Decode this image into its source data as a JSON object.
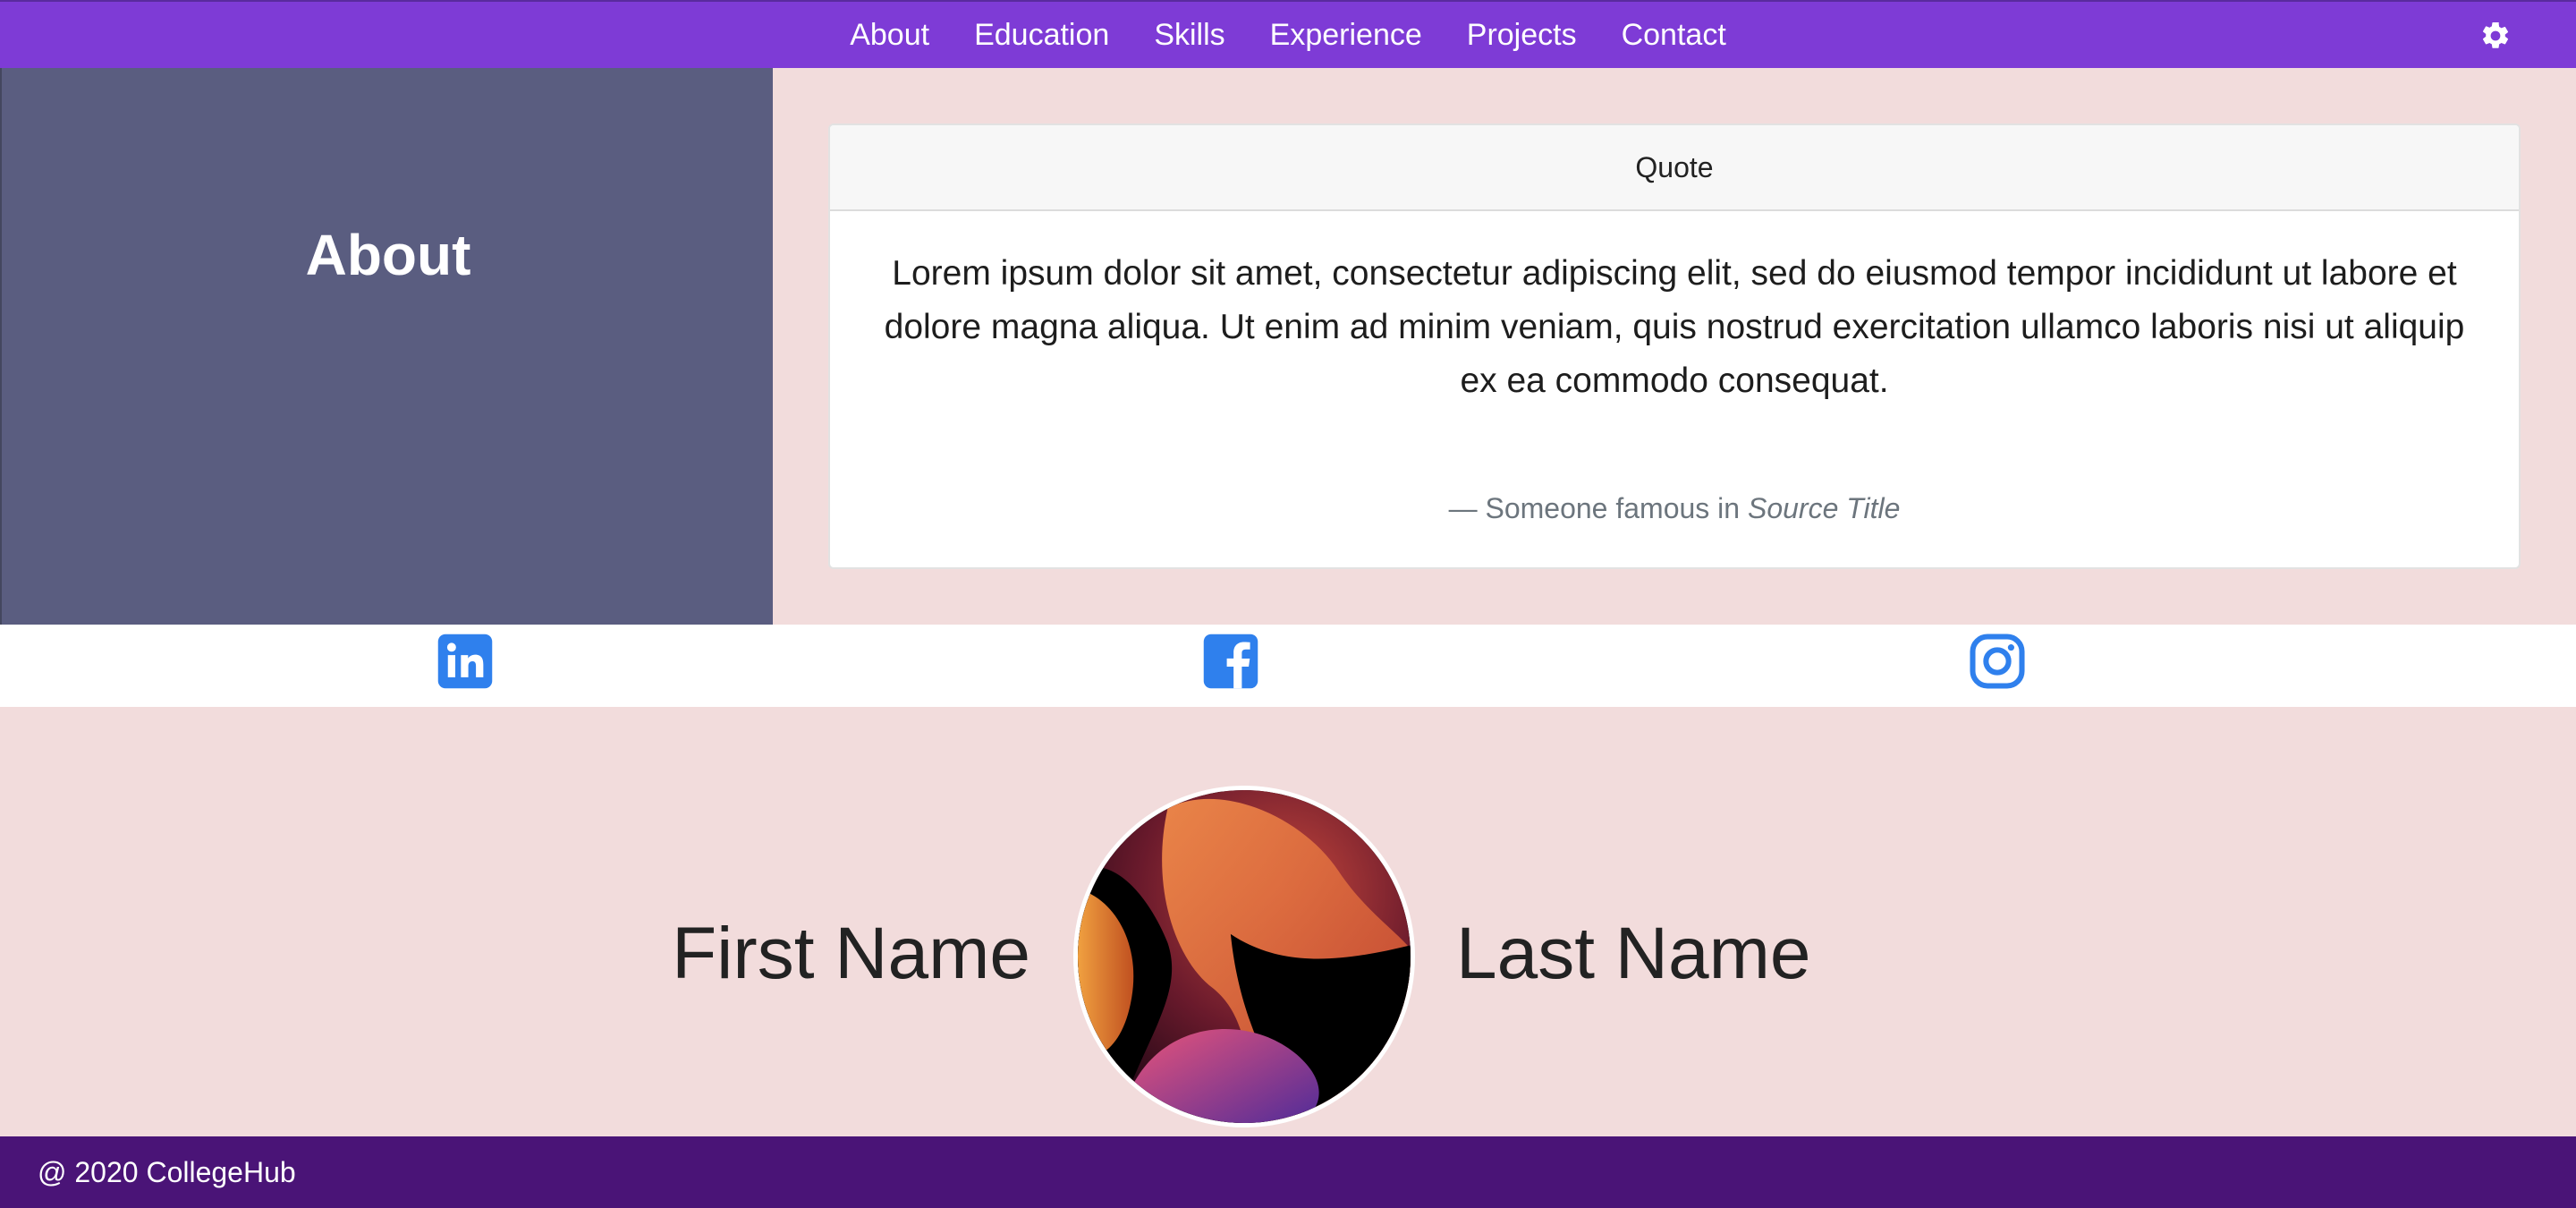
{
  "nav": {
    "links": [
      "About",
      "Education",
      "Skills",
      "Experience",
      "Projects",
      "Contact"
    ],
    "settings_icon": "gear-icon"
  },
  "about": {
    "title": "About",
    "card": {
      "header": "Quote",
      "quote": "Lorem ipsum dolor sit amet, consectetur adipiscing elit, sed do eiusmod tempor incididunt ut labore et dolore magna aliqua. Ut enim ad minim veniam, quis nostrud exercitation ullamco laboris nisi ut aliquip ex ea commodo consequat.",
      "footer_prefix": "— Someone famous in ",
      "source": "Source Title"
    }
  },
  "social": {
    "icons": [
      "linkedin-icon",
      "facebook-icon",
      "instagram-icon"
    ],
    "color": "#2f80ed"
  },
  "profile": {
    "first_name": "First Name",
    "last_name": "Last Name"
  },
  "footer": {
    "text": "@ 2020 CollegeHub"
  },
  "colors": {
    "navbar": "#7e3bd6",
    "sidebar": "#5a5d80",
    "background": "#f2dcdc",
    "footer": "#4a1477"
  }
}
